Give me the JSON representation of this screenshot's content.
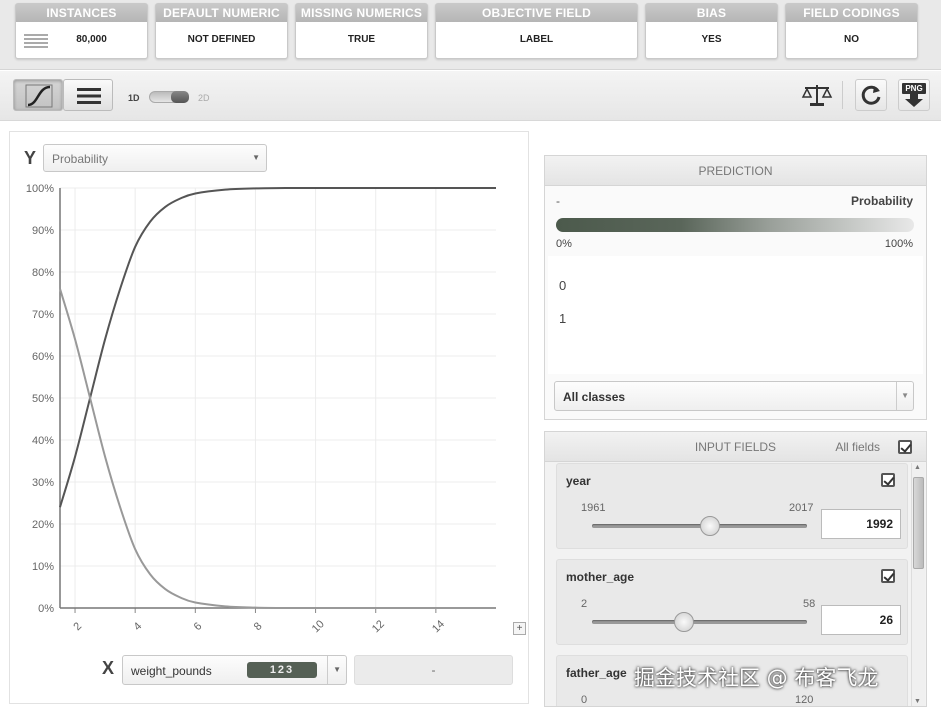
{
  "summary_cards": [
    {
      "header": "INSTANCES",
      "value": "80,000"
    },
    {
      "header": "DEFAULT NUMERIC",
      "value": "NOT DEFINED"
    },
    {
      "header": "MISSING NUMERICS",
      "value": "TRUE"
    },
    {
      "header": "OBJECTIVE FIELD",
      "value": "LABEL"
    },
    {
      "header": "BIAS",
      "value": "YES"
    },
    {
      "header": "FIELD CODINGS",
      "value": "NO"
    }
  ],
  "toolbar": {
    "toggle_left_label": "1D",
    "toggle_right_label": "2D",
    "export_label": "PNG"
  },
  "plot": {
    "y_axis_letter": "Y",
    "y_select_value": "Probability",
    "x_axis_letter": "X",
    "x_select_value": "weight_pounds",
    "x_type_badge": "123",
    "x_secondary_value": "-",
    "zoom_label": "+"
  },
  "chart_data": {
    "type": "line",
    "xlim": [
      1.5,
      16
    ],
    "ylim": [
      0,
      100
    ],
    "x_ticks": [
      2,
      4,
      6,
      8,
      10,
      12,
      14
    ],
    "y_ticks": [
      "0%",
      "10%",
      "20%",
      "30%",
      "40%",
      "50%",
      "60%",
      "70%",
      "80%",
      "90%",
      "100%"
    ],
    "grid": true,
    "series": [
      {
        "color": "#555555",
        "x": [
          1.5,
          2,
          2.5,
          3,
          3.5,
          4,
          4.5,
          5,
          5.5,
          6,
          7,
          8,
          9,
          10,
          12,
          14,
          16
        ],
        "y": [
          24,
          36,
          50,
          64,
          76,
          86,
          92,
          95.5,
          97.5,
          98.7,
          99.6,
          99.9,
          100,
          100,
          100,
          100,
          100
        ]
      },
      {
        "color": "#999999",
        "x": [
          1.5,
          2,
          2.5,
          3,
          3.5,
          4,
          4.5,
          5,
          5.5,
          6,
          7,
          8,
          9,
          10,
          12,
          14,
          16
        ],
        "y": [
          76,
          64,
          50,
          36,
          24,
          14,
          8,
          4.5,
          2.5,
          1.3,
          0.4,
          0.1,
          0,
          0,
          0,
          0,
          0
        ]
      }
    ]
  },
  "prediction": {
    "title": "PREDICTION",
    "predicted_value": "-",
    "metric_label": "Probability",
    "bar_min_label": "0%",
    "bar_max_label": "100%",
    "class_0": "0",
    "class_1": "1",
    "class_select_value": "All classes"
  },
  "input_fields": {
    "title": "INPUT FIELDS",
    "all_fields_label": "All fields",
    "fields": [
      {
        "name": "year",
        "min": "1961",
        "max": "2017",
        "value": "1992",
        "fraction": 0.55
      },
      {
        "name": "mother_age",
        "min": "2",
        "max": "58",
        "value": "26",
        "fraction": 0.43
      },
      {
        "name": "father_age",
        "min": "0",
        "max": "120",
        "value": "",
        "fraction": 0.3
      }
    ]
  },
  "watermark": "掘金技术社区 @ 布客飞龙"
}
